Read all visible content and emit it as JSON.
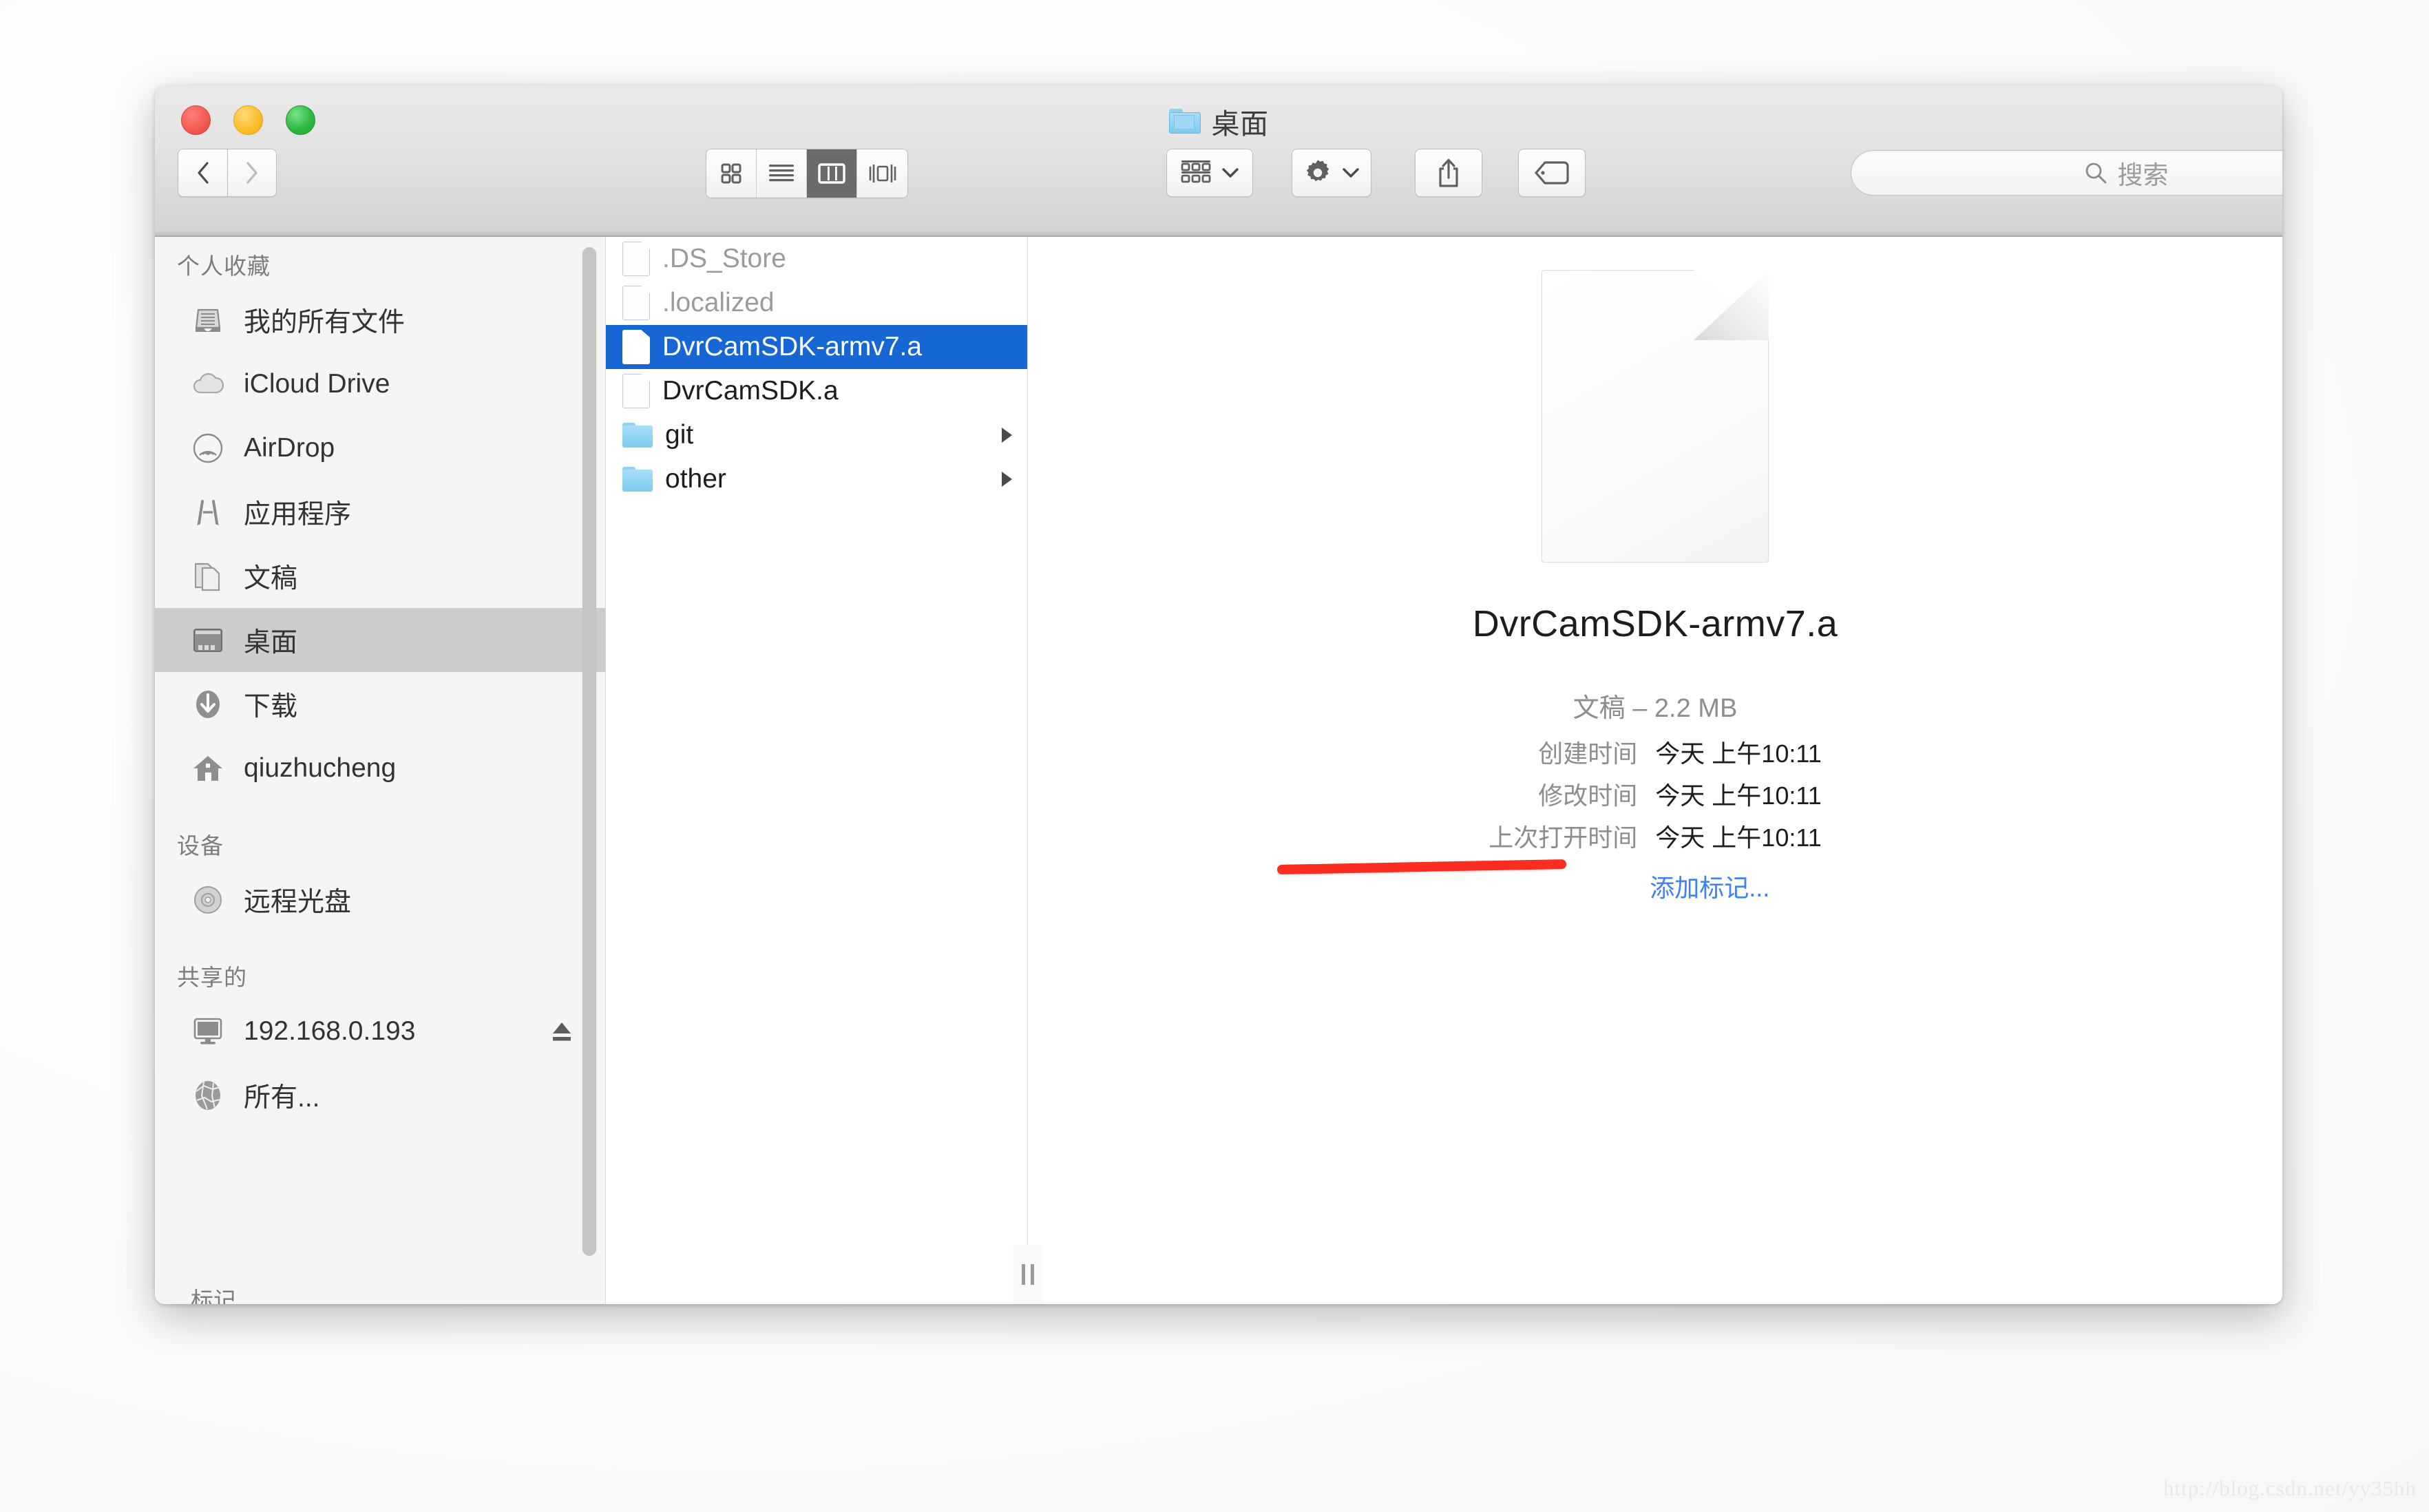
{
  "window": {
    "title": "桌面",
    "title_icon": "folder-icon",
    "traffic_lights": [
      {
        "name": "close-button",
        "color": "#f45c53"
      },
      {
        "name": "minimize-button",
        "color": "#fcbf2d"
      },
      {
        "name": "zoom-button",
        "color": "#2eb843"
      }
    ]
  },
  "toolbar": {
    "back_label": "‹",
    "forward_label": "›",
    "view_modes": [
      {
        "name": "icon-view",
        "icon": "grid-icon",
        "active": false
      },
      {
        "name": "list-view",
        "icon": "list-icon",
        "active": false
      },
      {
        "name": "column-view",
        "icon": "columns-icon",
        "active": true
      },
      {
        "name": "coverflow-view",
        "icon": "coverflow-icon",
        "active": false
      }
    ],
    "arrange_icon": "arrange-grid-icon",
    "action_icon": "gear-icon",
    "share_icon": "share-icon",
    "tag_icon": "tag-icon",
    "chevron": "chevron-down-icon"
  },
  "search": {
    "icon": "search-icon",
    "placeholder": "搜索",
    "value": ""
  },
  "sidebar": {
    "sections": [
      {
        "name": "favorites",
        "header": "个人收藏",
        "items": [
          {
            "label": "我的所有文件",
            "icon": "all-files-icon",
            "selected": false,
            "eject": false
          },
          {
            "label": "iCloud Drive",
            "icon": "cloud-icon",
            "selected": false,
            "eject": false
          },
          {
            "label": "AirDrop",
            "icon": "airdrop-icon",
            "selected": false,
            "eject": false
          },
          {
            "label": "应用程序",
            "icon": "applications-icon",
            "selected": false,
            "eject": false
          },
          {
            "label": "文稿",
            "icon": "documents-icon",
            "selected": false,
            "eject": false
          },
          {
            "label": "桌面",
            "icon": "desktop-icon",
            "selected": true,
            "eject": false
          },
          {
            "label": "下载",
            "icon": "downloads-icon",
            "selected": false,
            "eject": false
          },
          {
            "label": "qiuzhucheng",
            "icon": "home-icon",
            "selected": false,
            "eject": false
          }
        ]
      },
      {
        "name": "devices",
        "header": "设备",
        "items": [
          {
            "label": "远程光盘",
            "icon": "disc-icon",
            "selected": false,
            "eject": false
          }
        ]
      },
      {
        "name": "shared",
        "header": "共享的",
        "items": [
          {
            "label": "192.168.0.193",
            "icon": "display-icon",
            "selected": false,
            "eject": true
          },
          {
            "label": "所有...",
            "icon": "network-globe-icon",
            "selected": false,
            "eject": false
          }
        ]
      },
      {
        "name": "tags",
        "header": "标记",
        "items": []
      }
    ]
  },
  "file_column": {
    "items": [
      {
        "name": ".DS_Store",
        "type": "file",
        "hidden": true,
        "selected": false,
        "has_children": false
      },
      {
        "name": ".localized",
        "type": "file",
        "hidden": true,
        "selected": false,
        "has_children": false
      },
      {
        "name": "DvrCamSDK-armv7.a",
        "type": "file",
        "hidden": false,
        "selected": true,
        "has_children": false
      },
      {
        "name": "DvrCamSDK.a",
        "type": "file",
        "hidden": false,
        "selected": false,
        "has_children": false
      },
      {
        "name": "git",
        "type": "folder",
        "hidden": false,
        "selected": false,
        "has_children": true
      },
      {
        "name": "other",
        "type": "folder",
        "hidden": false,
        "selected": false,
        "has_children": true
      }
    ],
    "resize_handle": "column-resize-handle"
  },
  "preview": {
    "icon": "generic-document-icon",
    "filename": "DvrCamSDK-armv7.a",
    "kind_and_size": "文稿 – 2.2 MB",
    "metadata": [
      {
        "key": "创建时间",
        "value": "今天 上午10:11"
      },
      {
        "key": "修改时间",
        "value": "今天 上午10:11"
      },
      {
        "key": "上次打开时间",
        "value": "今天 上午10:11"
      }
    ],
    "add_tags_label": "添加标记..."
  },
  "annotation": {
    "type": "red-underline",
    "color": "#fb2c20"
  },
  "watermark": "http://blog.csdn.net/yy35hh",
  "colors": {
    "selection_blue": "#1667d4",
    "link_blue": "#3b82f6",
    "sidebar_selected": "#cdcdcd",
    "annotation_red": "#fb2c20"
  }
}
